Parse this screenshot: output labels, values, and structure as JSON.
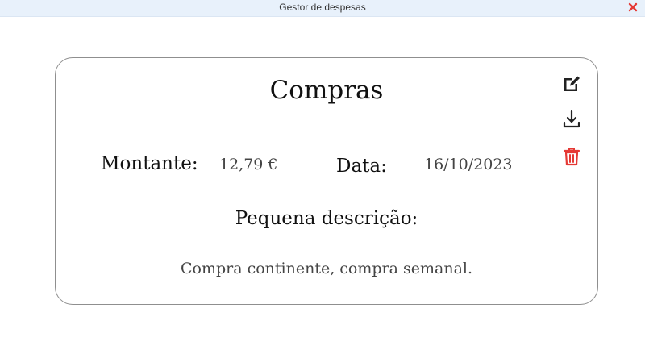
{
  "window": {
    "title": "Gestor de despesas",
    "close_icon": "close-icon",
    "close_color": "#e53935"
  },
  "expense": {
    "title": "Compras",
    "amount_label": "Montante:",
    "amount_value": "12,79 €",
    "date_label": "Data:",
    "date_value": "16/10/2023",
    "description_label": "Pequena descrição:",
    "description_text": "Compra continente, compra semanal."
  },
  "actions": {
    "edit_icon": "edit-icon",
    "download_icon": "download-icon",
    "delete_icon": "trash-icon",
    "delete_color": "#e53935"
  }
}
